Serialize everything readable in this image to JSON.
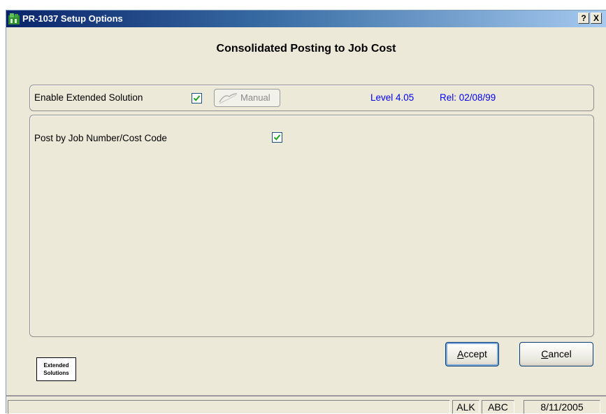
{
  "window": {
    "title": "PR-1037  Setup Options",
    "help_button": "?",
    "close_button": "X"
  },
  "heading": "Consolidated Posting to Job Cost",
  "extended": {
    "label": "Enable Extended Solution",
    "checked": true,
    "manual_label": "Manual",
    "level": "Level 4.05",
    "rel": "Rel: 02/08/99"
  },
  "options": {
    "post_by_job_label": "Post by Job Number/Cost Code",
    "post_by_job_checked": true
  },
  "logo": {
    "line1": "Extended",
    "line2": "Solutions"
  },
  "buttons": {
    "accept": "Accept",
    "cancel": "Cancel"
  },
  "status": {
    "left": "",
    "user": "ALK",
    "company": "ABC",
    "date": "8/11/2005"
  },
  "colors": {
    "title_gradient_start": "#0a246a",
    "window_bg": "#ece9d8",
    "check_green": "#21a121",
    "info_blue": "#0000ee"
  }
}
